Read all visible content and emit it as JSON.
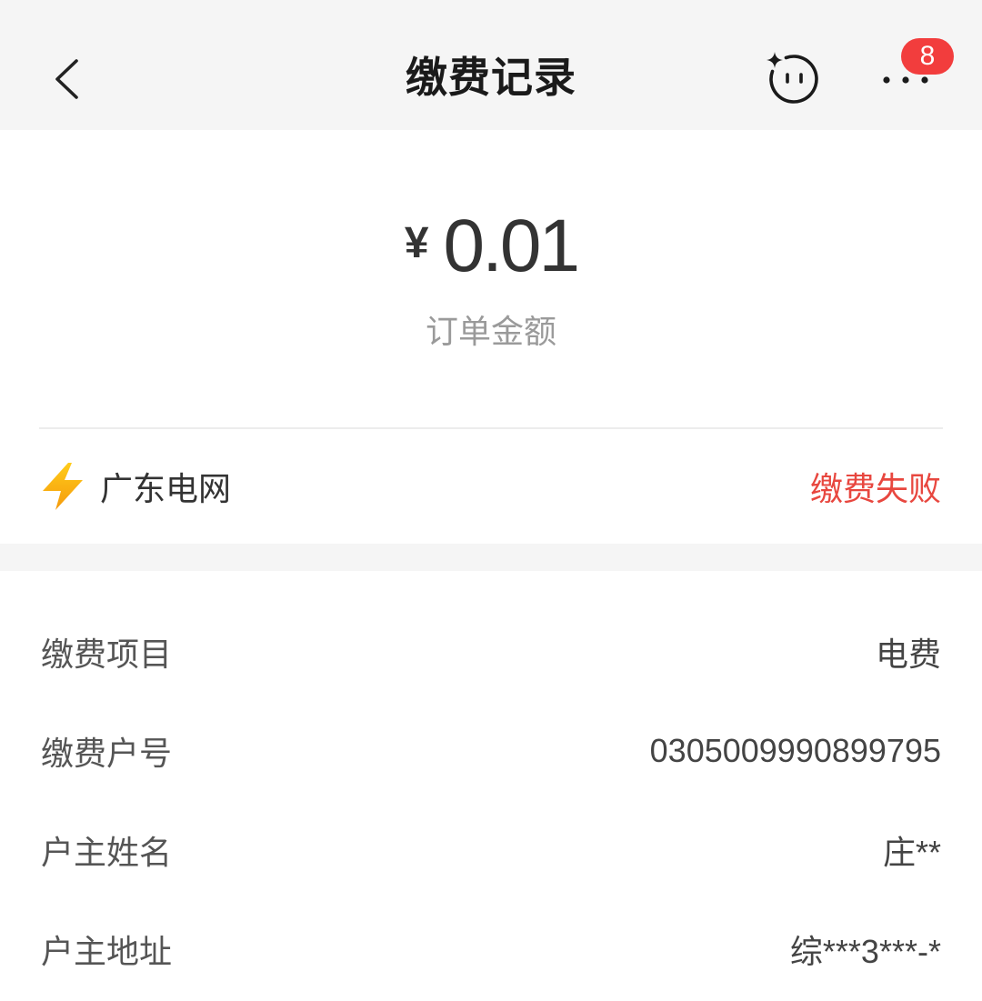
{
  "header": {
    "title": "缴费记录",
    "badge_count": "8",
    "icons": {
      "back": "chevron-left-icon",
      "assistant": "smiley-sparkle-icon",
      "more": "more-dots-icon"
    }
  },
  "amount": {
    "currency_symbol": "¥",
    "value": "0.01",
    "label": "订单金额"
  },
  "biller": {
    "icon": "lightning-icon",
    "name": "广东电网",
    "status": "缴费失败"
  },
  "details": [
    {
      "label": "缴费项目",
      "value": "电费"
    },
    {
      "label": "缴费户号",
      "value": "0305009990899795"
    },
    {
      "label": "户主姓名",
      "value": "庄**"
    },
    {
      "label": "户主地址",
      "value": "综***3***-*"
    }
  ],
  "colors": {
    "header_background": "#f5f5f5",
    "status_failed": "#e8473f",
    "badge": "#f23d3d",
    "lightning_top": "#ffcc1a",
    "lightning_bottom": "#f59a0c"
  }
}
